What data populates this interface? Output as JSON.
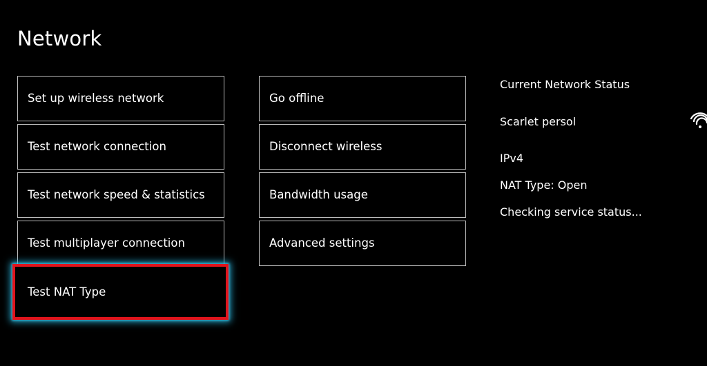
{
  "page": {
    "title": "Network"
  },
  "menu": {
    "column1": [
      {
        "label": "Set up wireless network"
      },
      {
        "label": "Test network connection"
      },
      {
        "label": "Test network speed & statistics"
      },
      {
        "label": "Test multiplayer connection"
      },
      {
        "label": "Test NAT Type",
        "focused": true
      }
    ],
    "column2": [
      {
        "label": "Go offline"
      },
      {
        "label": "Disconnect wireless"
      },
      {
        "label": "Bandwidth usage"
      },
      {
        "label": "Advanced settings"
      }
    ]
  },
  "status": {
    "heading": "Current Network Status",
    "network_name": "Scarlet persol",
    "ip_version": "IPv4",
    "nat_type": "NAT Type: Open",
    "service_status": "Checking service status...",
    "signal_icon": "wifi-signal-icon"
  },
  "colors": {
    "background": "#000000",
    "text": "#ffffff",
    "tile_border": "#bdbdbd",
    "focus_border": "#e0141c",
    "focus_glow": "#28b4dc"
  }
}
